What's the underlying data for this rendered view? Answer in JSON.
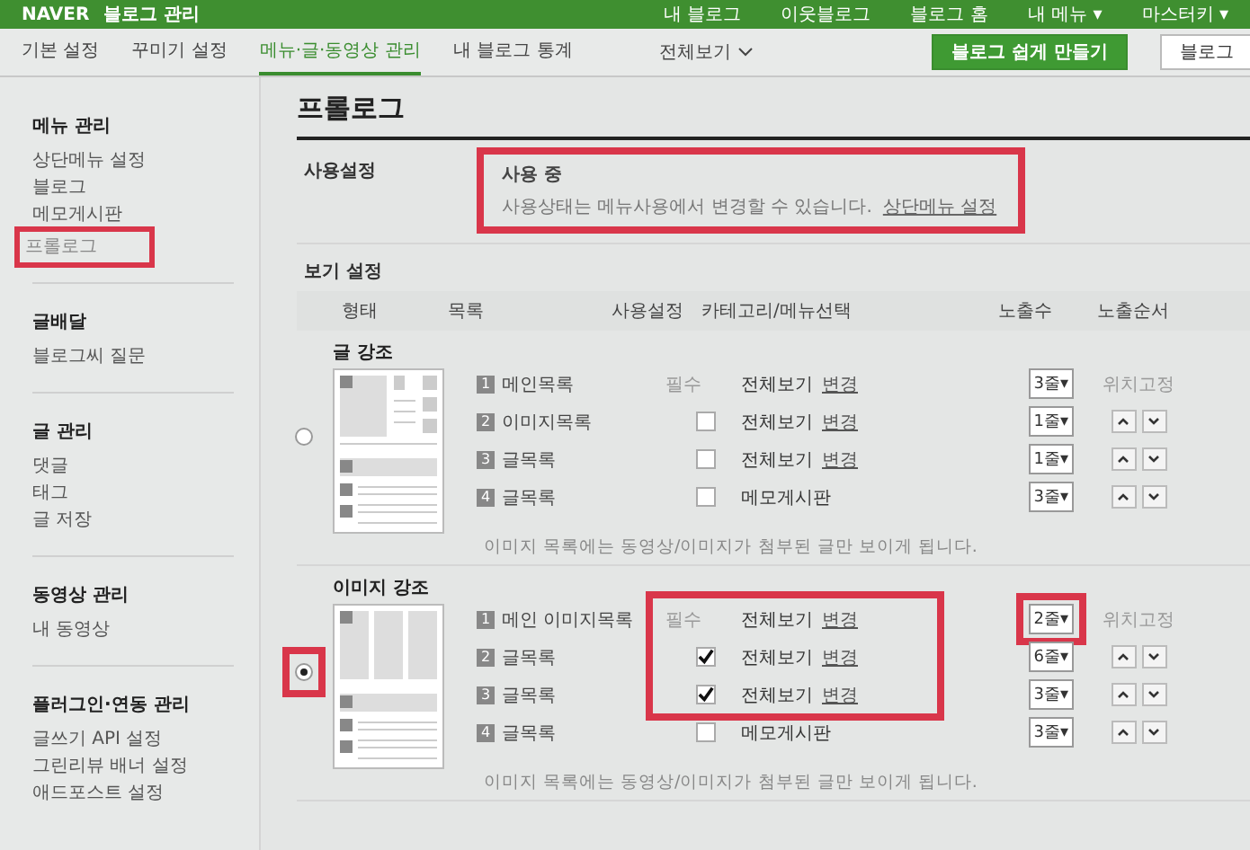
{
  "topbar": {
    "logo": "NAVER",
    "title": "블로그  관리",
    "links": [
      "내 블로그",
      "이웃블로그",
      "블로그 홈",
      "내 메뉴 ▾",
      "마스터키 ▾"
    ]
  },
  "nav": {
    "tabs": [
      {
        "label": "기본 설정",
        "selected": false
      },
      {
        "label": "꾸미기 설정",
        "selected": false
      },
      {
        "label": "메뉴·글·동영상 관리",
        "selected": true
      },
      {
        "label": "내 블로그 통계",
        "selected": false
      }
    ],
    "view_all": "전체보기",
    "buttons": [
      {
        "label": "블로그 쉽게 만들기",
        "kind": "primary"
      },
      {
        "label": "블로그",
        "kind": "plain"
      }
    ]
  },
  "sidebar": [
    {
      "title": "메뉴 관리",
      "items": [
        {
          "label": "상단메뉴 설정",
          "selected": false
        },
        {
          "label": "블로그",
          "selected": false
        },
        {
          "label": "메모게시판",
          "selected": false
        },
        {
          "label": "프롤로그",
          "selected": true
        }
      ]
    },
    {
      "title": "글배달",
      "items": [
        {
          "label": "블로그씨 질문",
          "selected": false
        }
      ]
    },
    {
      "title": "글 관리",
      "items": [
        {
          "label": "댓글",
          "selected": false
        },
        {
          "label": "태그",
          "selected": false
        },
        {
          "label": "글 저장",
          "selected": false
        }
      ]
    },
    {
      "title": "동영상 관리",
      "items": [
        {
          "label": "내 동영상",
          "selected": false
        }
      ]
    },
    {
      "title": "플러그인·연동 관리",
      "items": [
        {
          "label": "글쓰기 API 설정",
          "selected": false
        },
        {
          "label": "그린리뷰 배너 설정",
          "selected": false
        },
        {
          "label": "애드포스트 설정",
          "selected": false
        }
      ]
    }
  ],
  "page_title": "프롤로그",
  "usage": {
    "label": "사용설정",
    "status": "사용 중",
    "description": "사용상태는 메뉴사용에서 변경할 수 있습니다.",
    "link": "상단메뉴 설정",
    "highlighted": true
  },
  "view_settings": {
    "title": "보기 설정",
    "columns": [
      "형태",
      "목록",
      "사용설정",
      "카테고리/메뉴선택",
      "노출수",
      "노출순서"
    ],
    "layouts": [
      {
        "title": "글 강조",
        "kind": "text",
        "selected": false,
        "highlighted": false,
        "note": "이미지 목록에는 동영상/이미지가 첨부된 글만 보이게 됩니다.",
        "rows": [
          {
            "num": "1",
            "name": "메인목록",
            "use": {
              "kind": "required",
              "label": "필수"
            },
            "category": "전체보기",
            "link": "변경",
            "count": "3줄▾",
            "count_highlighted": false,
            "order": {
              "kind": "fixed",
              "label": "위치고정"
            }
          },
          {
            "num": "2",
            "name": "이미지목록",
            "use": {
              "kind": "checkbox",
              "checked": false
            },
            "category": "전체보기",
            "link": "변경",
            "count": "1줄▾",
            "count_highlighted": false,
            "order": {
              "kind": "arrows"
            }
          },
          {
            "num": "3",
            "name": "글목록",
            "use": {
              "kind": "checkbox",
              "checked": false
            },
            "category": "전체보기",
            "link": "변경",
            "count": "1줄▾",
            "count_highlighted": false,
            "order": {
              "kind": "arrows"
            }
          },
          {
            "num": "4",
            "name": "글목록",
            "use": {
              "kind": "checkbox",
              "checked": false
            },
            "category": "메모게시판",
            "count": "3줄▾",
            "count_highlighted": false,
            "order": {
              "kind": "arrows"
            }
          }
        ]
      },
      {
        "title": "이미지 강조",
        "kind": "image",
        "selected": true,
        "highlighted": true,
        "note": "이미지 목록에는 동영상/이미지가 첨부된 글만 보이게 됩니다.",
        "rows": [
          {
            "num": "1",
            "name": "메인 이미지목록",
            "use": {
              "kind": "required",
              "label": "필수"
            },
            "category": "전체보기",
            "link": "변경",
            "count": "2줄▾",
            "count_highlighted": true,
            "order": {
              "kind": "fixed",
              "label": "위치고정"
            }
          },
          {
            "num": "2",
            "name": "글목록",
            "use": {
              "kind": "checkbox",
              "checked": true
            },
            "category": "전체보기",
            "link": "변경",
            "count": "6줄▾",
            "count_highlighted": false,
            "order": {
              "kind": "arrows"
            }
          },
          {
            "num": "3",
            "name": "글목록",
            "use": {
              "kind": "checkbox",
              "checked": true
            },
            "category": "전체보기",
            "link": "변경",
            "count": "3줄▾",
            "count_highlighted": false,
            "order": {
              "kind": "arrows"
            }
          },
          {
            "num": "4",
            "name": "글목록",
            "use": {
              "kind": "checkbox",
              "checked": false
            },
            "category": "메모게시판",
            "count": "3줄▾",
            "count_highlighted": false,
            "order": {
              "kind": "arrows"
            }
          }
        ]
      }
    ]
  }
}
